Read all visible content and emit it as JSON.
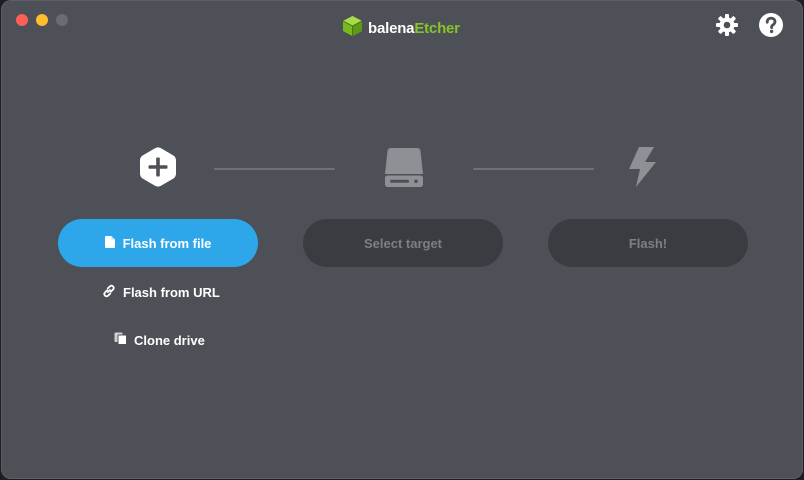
{
  "app": {
    "brand_part1": "balena",
    "brand_part2": "Etcher",
    "brand_color": "#85c52a",
    "logo_icon": "balena-cube-icon"
  },
  "window_controls": [
    "close",
    "minimize",
    "maximize"
  ],
  "toolbar": {
    "settings_icon": "gear-icon",
    "help_icon": "help-icon"
  },
  "steps": {
    "source": {
      "icon": "plus-hexagon-icon",
      "button_label": "Flash from file",
      "button_icon": "file-icon",
      "button_color": "#2ea7ea"
    },
    "target": {
      "icon": "drive-icon",
      "button_label": "Select target"
    },
    "flash": {
      "icon": "lightning-icon",
      "button_label": "Flash!"
    }
  },
  "source_options": {
    "url_label": "Flash from URL",
    "url_icon": "link-icon",
    "clone_label": "Clone drive",
    "clone_icon": "copy-icon"
  }
}
